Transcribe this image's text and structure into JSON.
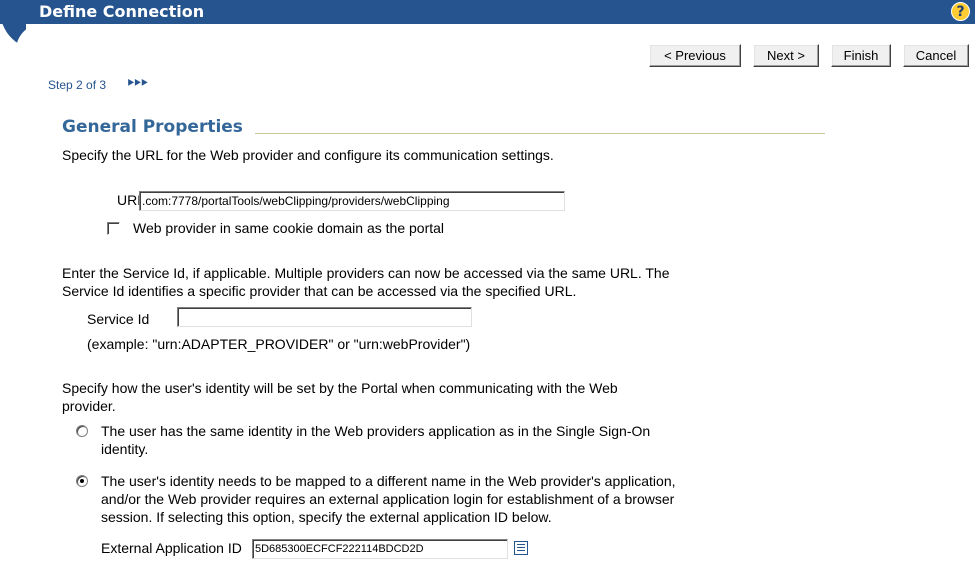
{
  "header": {
    "title": "Define Connection",
    "help_icon": "help-icon",
    "help_glyph": "?",
    "color": "#26548f"
  },
  "buttons": {
    "previous": "< Previous",
    "next": "Next >",
    "finish": "Finish",
    "cancel": "Cancel"
  },
  "step": {
    "text": "Step 2 of 3",
    "arrows": "⯈⯈⯈"
  },
  "section": {
    "title": "General Properties",
    "intro": "Specify the URL for the Web provider and configure its communication settings."
  },
  "url": {
    "label": "URL",
    "value": ".com:7778/portalTools/webClipping/providers/webClipping"
  },
  "cookie": {
    "label": "Web provider in same cookie domain as the portal",
    "checked": false
  },
  "service": {
    "intro_line1": "Enter the Service Id, if applicable. Multiple providers can now be accessed via the same URL. The",
    "intro_line2": "Service Id identifies a specific provider that can be accessed via the specified URL.",
    "label": "Service Id",
    "value": "",
    "example": "(example: \"urn:ADAPTER_PROVIDER\" or \"urn:webProvider\")"
  },
  "identity": {
    "intro_line1": "Specify how the user's identity will be set by the Portal when communicating with the Web",
    "intro_line2": "provider.",
    "option1_line1": "The user has the same identity in the Web providers application as in the Single Sign-On",
    "option1_line2": "identity.",
    "option1_selected": false,
    "option2_line1": "The user's identity needs to be mapped to a different name in the Web provider's application,",
    "option2_line2": "and/or the Web provider requires an external application login for establishment of a browser",
    "option2_line3": "session. If selecting this option, specify the external application ID below.",
    "option2_selected": true,
    "ext_app_label": "External Application ID",
    "ext_app_value": "5D685300ECFCF222114BDCD2D",
    "lov_icon": "list-of-values-icon"
  }
}
